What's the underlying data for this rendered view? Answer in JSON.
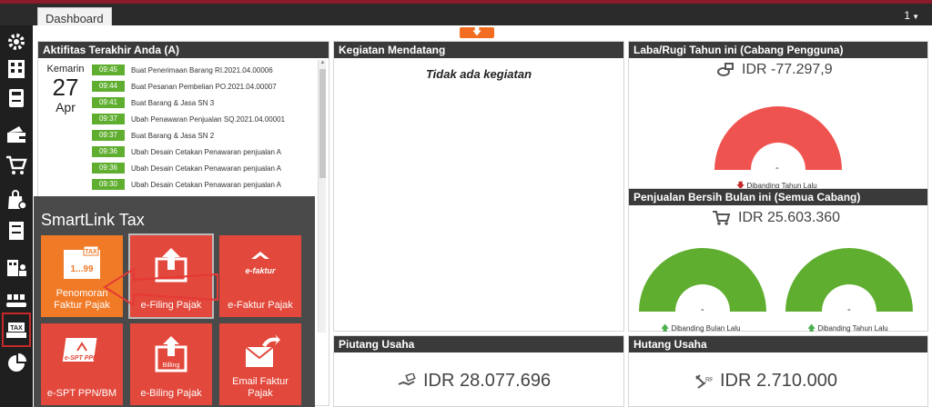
{
  "window": {
    "tab_label": "Dashboard",
    "notification_count": "1"
  },
  "activity": {
    "title": "Aktifitas Terakhir Anda (A)",
    "date_label": "Kemarin",
    "day": "27",
    "month": "Apr",
    "items": [
      {
        "time": "09:45",
        "text": "Buat Penerimaan Barang RI.2021.04.00006"
      },
      {
        "time": "09:44",
        "text": "Buat Pesanan Pembelian PO.2021.04.00007"
      },
      {
        "time": "09:41",
        "text": "Buat Barang & Jasa SN 3"
      },
      {
        "time": "09:37",
        "text": "Ubah Penawaran Penjualan SQ.2021.04.00001"
      },
      {
        "time": "09:37",
        "text": "Buat Barang & Jasa SN 2"
      },
      {
        "time": "09:36",
        "text": "Ubah Desain Cetakan Penawaran penjualan A"
      },
      {
        "time": "09:36",
        "text": "Ubah Desain Cetakan Penawaran penjualan A"
      },
      {
        "time": "09:30",
        "text": "Ubah Desain Cetakan Penawaran penjualan A"
      }
    ]
  },
  "upcoming": {
    "title": "Kegiatan Mendatang",
    "empty_text": "Tidak ada kegiatan"
  },
  "profit": {
    "title": "Laba/Rugi Tahun ini (Cabang Pengguna)",
    "amount": "IDR -77.297,9",
    "dash": "-",
    "note": "Dibanding Tahun Lalu",
    "gauge_color": "#ef5350"
  },
  "net_sales": {
    "title": "Penjualan Bersih Bulan ini (Semua Cabang)",
    "amount": "IDR 25.603.360",
    "gauge_color": "#5fae2f",
    "gauges": [
      {
        "dash": "-",
        "note": "Dibanding Bulan Lalu"
      },
      {
        "dash": "-",
        "note": "Dibanding Tahun Lalu"
      }
    ]
  },
  "receivables": {
    "title": "Piutang Usaha",
    "amount": "IDR 28.077.696"
  },
  "payables": {
    "title": "Hutang Usaha",
    "amount": "IDR 2.710.000"
  },
  "smartlink": {
    "title": "SmartLink Tax",
    "tiles": [
      {
        "label": "Penomoran Faktur Pajak",
        "icon_text_top": "TAX",
        "icon_text_num": "1...99"
      },
      {
        "label": "e-Filing Pajak"
      },
      {
        "label": "e-Faktur Pajak",
        "icon_text": "e-faktur"
      },
      {
        "label": "e-SPT PPN/BM",
        "icon_text": "e-SPT PPN"
      },
      {
        "label": "e-Biling Pajak",
        "icon_text": "Billing"
      },
      {
        "label": "Email Faktur Pajak"
      }
    ]
  },
  "colors": {
    "accent_orange": "#f07a26",
    "tile_red": "#e2483b",
    "header_dark": "#3a3a3a",
    "time_green": "#5fae2f"
  }
}
